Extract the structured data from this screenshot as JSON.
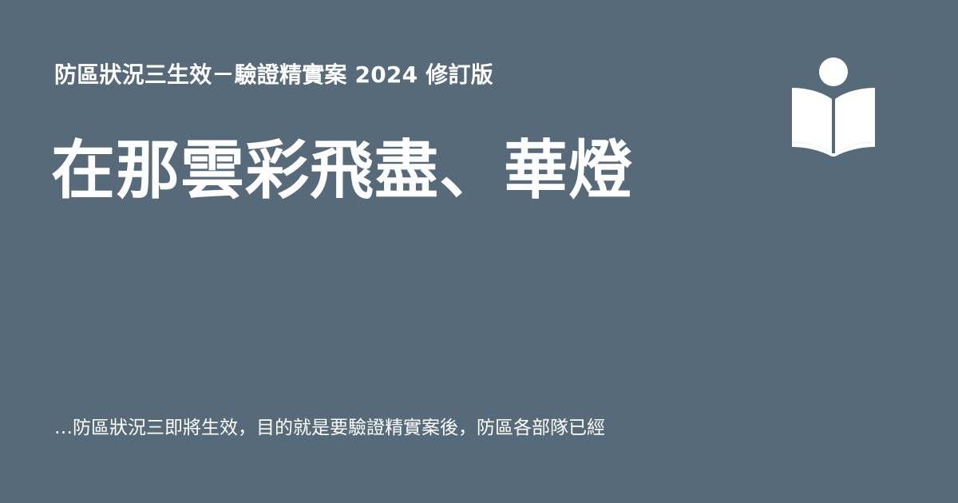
{
  "header": {
    "subtitle": "防區狀況三生效－驗證精實案 2024 修訂版"
  },
  "main": {
    "title": "在那雲彩飛盡、華燈"
  },
  "excerpt": {
    "text": "…防區狀況三即將生效，目的就是要驗證精實案後，防區各部隊已經"
  },
  "logo": {
    "icon": "reading-book-icon",
    "color": "#ffffff"
  },
  "colors": {
    "background": "#566a79",
    "text": "#ffffff"
  }
}
